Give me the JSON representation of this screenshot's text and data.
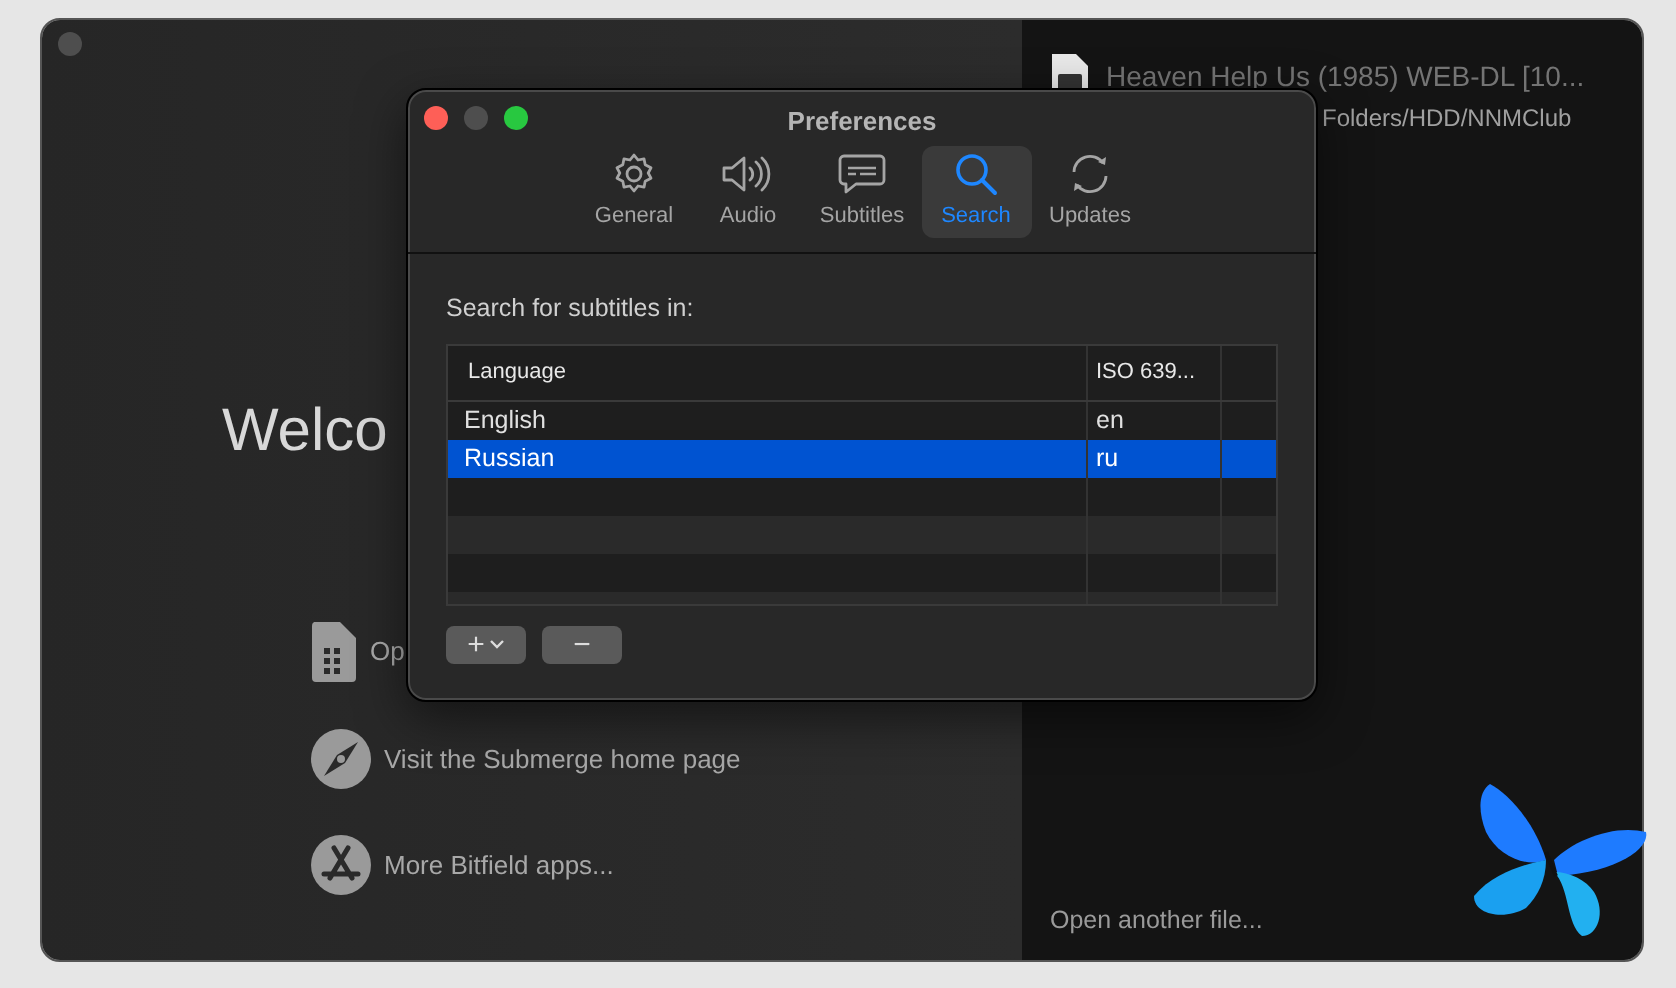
{
  "main_window": {
    "welcome_title": "Welco",
    "actions": [
      {
        "kind": "file",
        "label": "Op"
      },
      {
        "kind": "compass",
        "label": "Visit the Submerge home page"
      },
      {
        "kind": "store",
        "label": "More Bitfield apps..."
      }
    ],
    "recent_file": {
      "title": "Heaven Help Us (1985) WEB-DL [10...",
      "path": "Folders/HDD/NNMClub"
    },
    "open_another": "Open another file..."
  },
  "preferences": {
    "title": "Preferences",
    "tabs": [
      {
        "kind": "gear",
        "label": "General",
        "selected": false
      },
      {
        "kind": "speaker",
        "label": "Audio",
        "selected": false
      },
      {
        "kind": "bubble",
        "label": "Subtitles",
        "selected": false
      },
      {
        "kind": "search",
        "label": "Search",
        "selected": true
      },
      {
        "kind": "update",
        "label": "Updates",
        "selected": false
      }
    ],
    "prompt": "Search for subtitles in:",
    "table": {
      "columns": [
        "Language",
        "ISO 639..."
      ],
      "rows": [
        {
          "cells": [
            "English",
            "en"
          ],
          "selected": false
        },
        {
          "cells": [
            "Russian",
            "ru"
          ],
          "selected": true
        }
      ]
    },
    "buttons": [
      {
        "kind": "add",
        "label": "+"
      },
      {
        "kind": "remove",
        "label": "−"
      }
    ]
  }
}
